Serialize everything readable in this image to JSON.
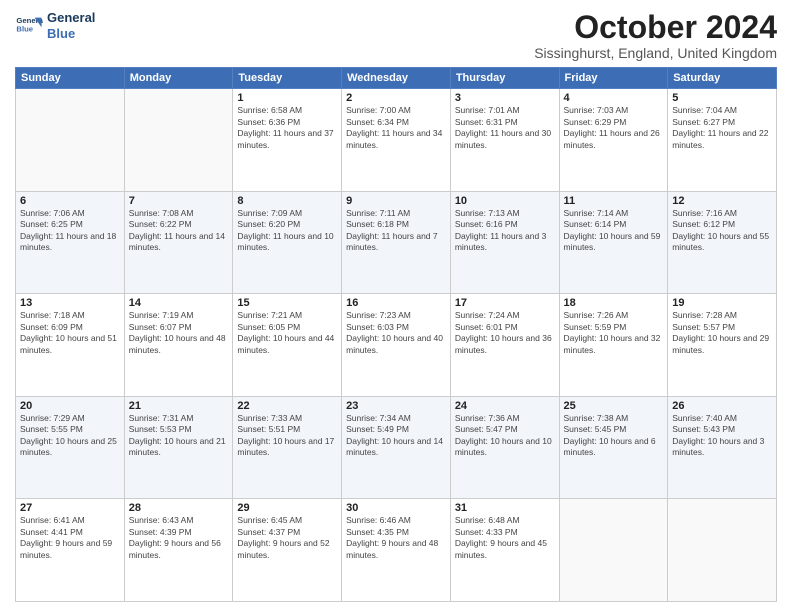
{
  "header": {
    "logo_line1": "General",
    "logo_line2": "Blue",
    "title": "October 2024",
    "subtitle": "Sissinghurst, England, United Kingdom"
  },
  "days_of_week": [
    "Sunday",
    "Monday",
    "Tuesday",
    "Wednesday",
    "Thursday",
    "Friday",
    "Saturday"
  ],
  "weeks": [
    {
      "days": [
        {
          "num": "",
          "info": ""
        },
        {
          "num": "",
          "info": ""
        },
        {
          "num": "1",
          "info": "Sunrise: 6:58 AM\nSunset: 6:36 PM\nDaylight: 11 hours and 37 minutes."
        },
        {
          "num": "2",
          "info": "Sunrise: 7:00 AM\nSunset: 6:34 PM\nDaylight: 11 hours and 34 minutes."
        },
        {
          "num": "3",
          "info": "Sunrise: 7:01 AM\nSunset: 6:31 PM\nDaylight: 11 hours and 30 minutes."
        },
        {
          "num": "4",
          "info": "Sunrise: 7:03 AM\nSunset: 6:29 PM\nDaylight: 11 hours and 26 minutes."
        },
        {
          "num": "5",
          "info": "Sunrise: 7:04 AM\nSunset: 6:27 PM\nDaylight: 11 hours and 22 minutes."
        }
      ]
    },
    {
      "days": [
        {
          "num": "6",
          "info": "Sunrise: 7:06 AM\nSunset: 6:25 PM\nDaylight: 11 hours and 18 minutes."
        },
        {
          "num": "7",
          "info": "Sunrise: 7:08 AM\nSunset: 6:22 PM\nDaylight: 11 hours and 14 minutes."
        },
        {
          "num": "8",
          "info": "Sunrise: 7:09 AM\nSunset: 6:20 PM\nDaylight: 11 hours and 10 minutes."
        },
        {
          "num": "9",
          "info": "Sunrise: 7:11 AM\nSunset: 6:18 PM\nDaylight: 11 hours and 7 minutes."
        },
        {
          "num": "10",
          "info": "Sunrise: 7:13 AM\nSunset: 6:16 PM\nDaylight: 11 hours and 3 minutes."
        },
        {
          "num": "11",
          "info": "Sunrise: 7:14 AM\nSunset: 6:14 PM\nDaylight: 10 hours and 59 minutes."
        },
        {
          "num": "12",
          "info": "Sunrise: 7:16 AM\nSunset: 6:12 PM\nDaylight: 10 hours and 55 minutes."
        }
      ]
    },
    {
      "days": [
        {
          "num": "13",
          "info": "Sunrise: 7:18 AM\nSunset: 6:09 PM\nDaylight: 10 hours and 51 minutes."
        },
        {
          "num": "14",
          "info": "Sunrise: 7:19 AM\nSunset: 6:07 PM\nDaylight: 10 hours and 48 minutes."
        },
        {
          "num": "15",
          "info": "Sunrise: 7:21 AM\nSunset: 6:05 PM\nDaylight: 10 hours and 44 minutes."
        },
        {
          "num": "16",
          "info": "Sunrise: 7:23 AM\nSunset: 6:03 PM\nDaylight: 10 hours and 40 minutes."
        },
        {
          "num": "17",
          "info": "Sunrise: 7:24 AM\nSunset: 6:01 PM\nDaylight: 10 hours and 36 minutes."
        },
        {
          "num": "18",
          "info": "Sunrise: 7:26 AM\nSunset: 5:59 PM\nDaylight: 10 hours and 32 minutes."
        },
        {
          "num": "19",
          "info": "Sunrise: 7:28 AM\nSunset: 5:57 PM\nDaylight: 10 hours and 29 minutes."
        }
      ]
    },
    {
      "days": [
        {
          "num": "20",
          "info": "Sunrise: 7:29 AM\nSunset: 5:55 PM\nDaylight: 10 hours and 25 minutes."
        },
        {
          "num": "21",
          "info": "Sunrise: 7:31 AM\nSunset: 5:53 PM\nDaylight: 10 hours and 21 minutes."
        },
        {
          "num": "22",
          "info": "Sunrise: 7:33 AM\nSunset: 5:51 PM\nDaylight: 10 hours and 17 minutes."
        },
        {
          "num": "23",
          "info": "Sunrise: 7:34 AM\nSunset: 5:49 PM\nDaylight: 10 hours and 14 minutes."
        },
        {
          "num": "24",
          "info": "Sunrise: 7:36 AM\nSunset: 5:47 PM\nDaylight: 10 hours and 10 minutes."
        },
        {
          "num": "25",
          "info": "Sunrise: 7:38 AM\nSunset: 5:45 PM\nDaylight: 10 hours and 6 minutes."
        },
        {
          "num": "26",
          "info": "Sunrise: 7:40 AM\nSunset: 5:43 PM\nDaylight: 10 hours and 3 minutes."
        }
      ]
    },
    {
      "days": [
        {
          "num": "27",
          "info": "Sunrise: 6:41 AM\nSunset: 4:41 PM\nDaylight: 9 hours and 59 minutes."
        },
        {
          "num": "28",
          "info": "Sunrise: 6:43 AM\nSunset: 4:39 PM\nDaylight: 9 hours and 56 minutes."
        },
        {
          "num": "29",
          "info": "Sunrise: 6:45 AM\nSunset: 4:37 PM\nDaylight: 9 hours and 52 minutes."
        },
        {
          "num": "30",
          "info": "Sunrise: 6:46 AM\nSunset: 4:35 PM\nDaylight: 9 hours and 48 minutes."
        },
        {
          "num": "31",
          "info": "Sunrise: 6:48 AM\nSunset: 4:33 PM\nDaylight: 9 hours and 45 minutes."
        },
        {
          "num": "",
          "info": ""
        },
        {
          "num": "",
          "info": ""
        }
      ]
    }
  ]
}
